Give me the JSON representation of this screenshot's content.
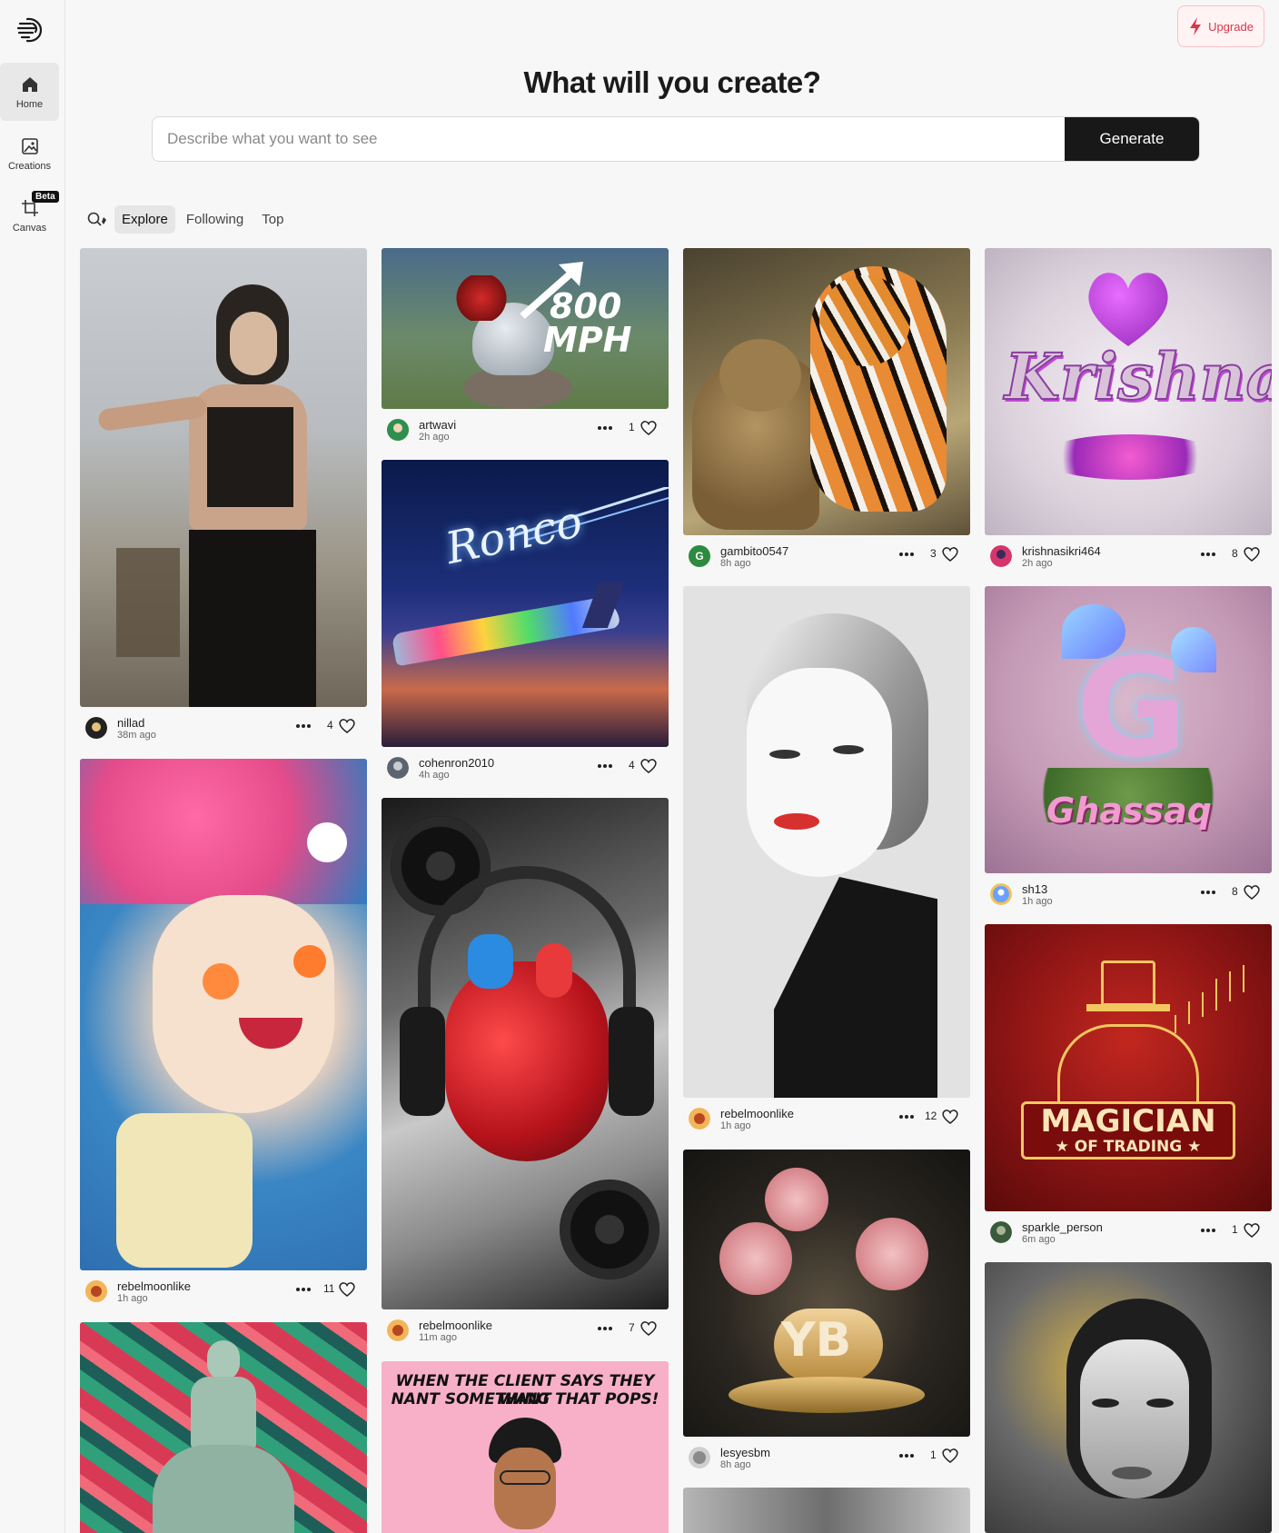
{
  "sidebar": {
    "items": [
      {
        "label": "Home",
        "icon": "home-icon"
      },
      {
        "label": "Creations",
        "icon": "image-icon"
      },
      {
        "label": "Canvas",
        "icon": "crop-icon"
      }
    ],
    "beta_badge": "Beta"
  },
  "upgrade": {
    "label": "Upgrade"
  },
  "headline": "What will you create?",
  "prompt": {
    "placeholder": "Describe what you want to see",
    "value": "",
    "button": "Generate"
  },
  "tabs": [
    {
      "label": "Explore",
      "active": true
    },
    {
      "label": "Following",
      "active": false
    },
    {
      "label": "Top",
      "active": false
    }
  ],
  "feed": [
    {
      "user": "nillad",
      "time": "38m ago",
      "likes": "4"
    },
    {
      "user": "rebelmoonlike",
      "time": "1h ago",
      "likes": "11"
    },
    {
      "user": "artwavi",
      "time": "2h ago",
      "likes": "1",
      "image_text": [
        "800",
        "MPH"
      ]
    },
    {
      "user": "cohenron2010",
      "time": "4h ago",
      "likes": "4",
      "image_text": [
        "Ronco"
      ]
    },
    {
      "user": "rebelmoonlike",
      "time": "11m ago",
      "likes": "7"
    },
    {
      "user": "gambito0547",
      "time": "8h ago",
      "likes": "3",
      "avatar_letter": "G"
    },
    {
      "user": "rebelmoonlike",
      "time": "1h ago",
      "likes": "12"
    },
    {
      "user": "lesyesbm",
      "time": "8h ago",
      "likes": "1",
      "image_text": [
        "YB"
      ]
    },
    {
      "user": "krishnasikri464",
      "time": "2h ago",
      "likes": "8",
      "image_text": [
        "Krishna"
      ]
    },
    {
      "user": "sh13",
      "time": "1h ago",
      "likes": "8",
      "image_text": [
        "G",
        "Ghassaq"
      ]
    },
    {
      "user": "sparkle_person",
      "time": "6m ago",
      "likes": "1",
      "image_text": [
        "MAGICIAN",
        "★ OF TRADING ★"
      ]
    }
  ],
  "extra_image_text": {
    "meme": [
      "WHEN THE CLIENT SAYS THEY WANT",
      "NANT SOMETHING THAT POPS!"
    ]
  },
  "colors": {
    "accent": "#d9374b",
    "generate_bg": "#181818",
    "page_bg": "#f7f7f7"
  }
}
